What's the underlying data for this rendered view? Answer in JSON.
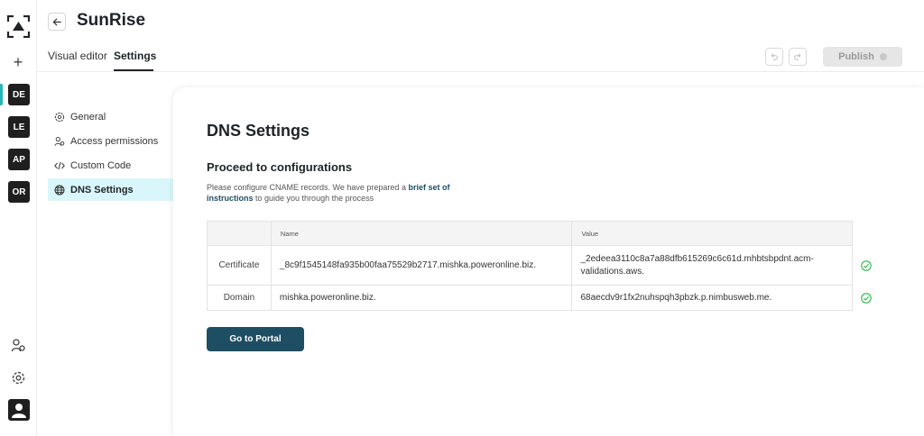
{
  "rail": {
    "workspaces": [
      {
        "initials": "DE",
        "active": true
      },
      {
        "initials": "LE",
        "active": false
      },
      {
        "initials": "AP",
        "active": false
      },
      {
        "initials": "OR",
        "active": false
      }
    ],
    "add_icon": "plus-icon",
    "accent_color": "#25b5b9"
  },
  "header": {
    "title": "SunRise",
    "tabs": [
      {
        "label": "Visual editor",
        "active": false
      },
      {
        "label": "Settings",
        "active": true
      }
    ],
    "publish_label": "Publish"
  },
  "settings_nav": [
    {
      "label": "General",
      "icon": "gear-icon",
      "active": false
    },
    {
      "label": "Access permissions",
      "icon": "users-icon",
      "active": false
    },
    {
      "label": "Custom Code",
      "icon": "code-icon",
      "active": false
    },
    {
      "label": "DNS Settings",
      "icon": "globe-icon",
      "active": true
    }
  ],
  "main": {
    "title": "DNS Settings",
    "subtitle": "Proceed to configurations",
    "description_pre": "Please configure CNAME records. We have prepared a ",
    "description_link": "brief set of instructions",
    "description_post": " to guide you through the process",
    "table": {
      "headers": [
        "",
        "Name",
        "Value"
      ],
      "rows": [
        {
          "type": "Certificate",
          "name": "_8c9f1545148fa935b00faa75529b2717.mishka.poweronline.biz.",
          "value": "_2edeea3110c8a7a88dfb615269c6c61d.mhbtsbpdnt.acm-validations.aws.",
          "verified": true
        },
        {
          "type": "Domain",
          "name": "mishka.poweronline.biz.",
          "value": "68aecdv9r1fx2nuhspqh3pbzk.p.nimbusweb.me.",
          "verified": true
        }
      ]
    },
    "portal_button": "Go to Portal",
    "primary_color": "#1e4e63",
    "success_color": "#2fb54a"
  }
}
